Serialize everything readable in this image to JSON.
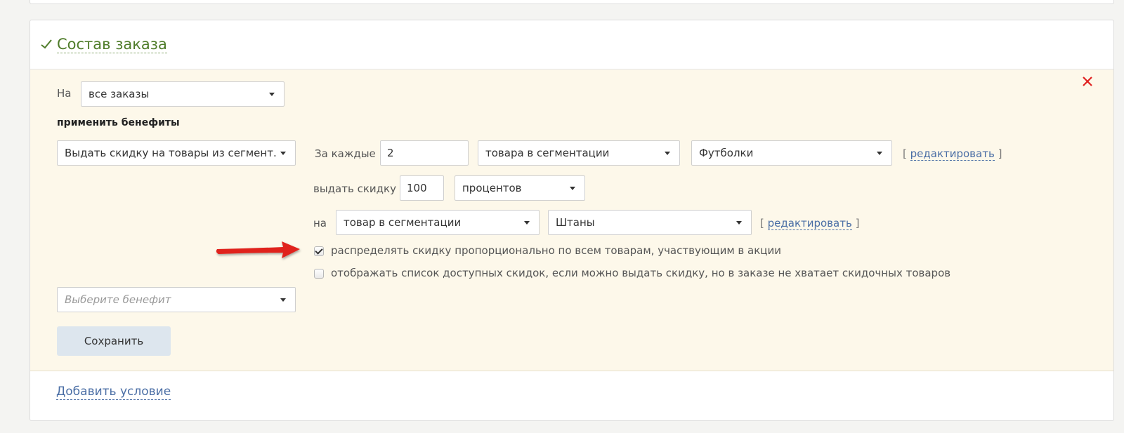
{
  "section": {
    "title": "Состав заказа",
    "add_condition": "Добавить условие"
  },
  "rule": {
    "on_label": "На",
    "orders_select": "все заказы",
    "apply_benefits_label": "применить бенефиты",
    "benefit_select": "Выдать скидку на товары из сегмент.",
    "for_each_label": "За каждые",
    "for_each_qty": "2",
    "for_each_type": "товара в сегментации",
    "for_each_segment": "Футболки",
    "edit_link_1": "редактировать",
    "give_discount_label": "выдать скидку",
    "discount_value": "100",
    "discount_unit": "процентов",
    "on_label_2": "на",
    "target_type": "товар в сегментации",
    "target_segment": "Штаны",
    "edit_link_2": "редактировать",
    "checkbox_distribute": "распределять скидку пропорционально по всем товарам, участвующим в акции",
    "checkbox_distribute_checked": true,
    "checkbox_show_list": "отображать список доступных скидок, если можно выдать скидку, но в заказе не хватает скидочных товаров",
    "checkbox_show_list_checked": false,
    "choose_benefit_placeholder": "Выберите бенефит",
    "save_button": "Сохранить"
  },
  "icons": {
    "check": "checkmark-icon",
    "close": "close-icon",
    "annotation_arrow": "red-arrow-icon"
  },
  "colors": {
    "accent_green": "#4f7c2a",
    "link_blue": "#4a6ea5",
    "panel_bg": "#fdf8ea",
    "close_red": "#e02020",
    "arrow_red": "#e0201a"
  }
}
